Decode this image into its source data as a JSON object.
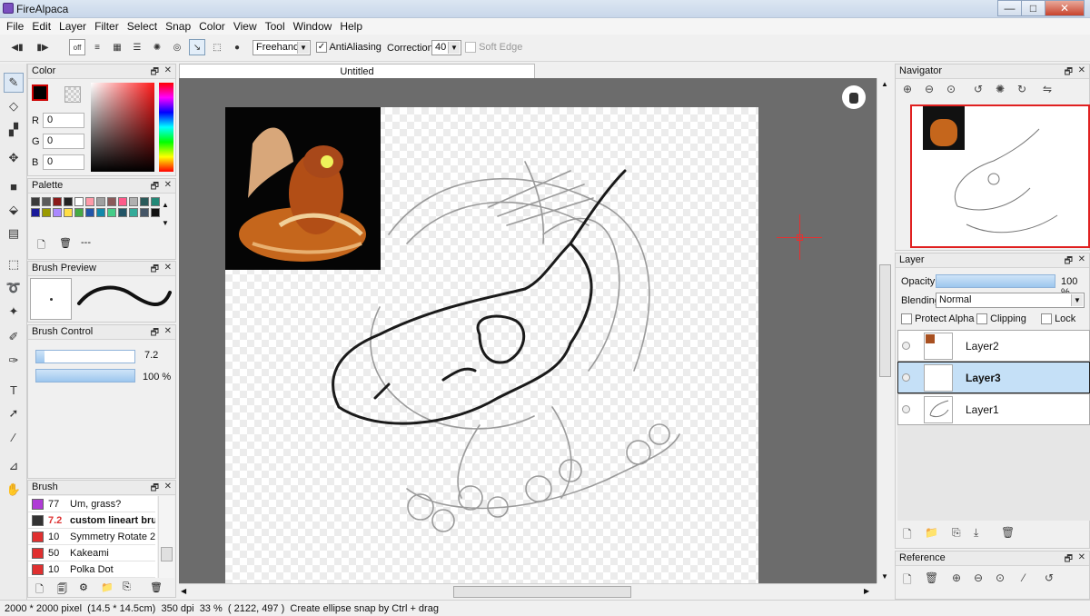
{
  "window": {
    "title": "FireAlpaca",
    "minimize": "—",
    "maximize": "□",
    "close": "✕"
  },
  "menu": [
    "File",
    "Edit",
    "Layer",
    "Filter",
    "Select",
    "Snap",
    "Color",
    "View",
    "Tool",
    "Window",
    "Help"
  ],
  "toolbar": {
    "off_label": "off",
    "brush_mode": "Freehand",
    "antialiasing_label": "AntiAliasing",
    "antialiasing_checked": true,
    "correction_label": "Correction",
    "correction_value": "40",
    "soft_edge_label": "Soft Edge",
    "soft_edge_checked": false
  },
  "document_tab": "Untitled",
  "color_panel": {
    "title": "Color",
    "r_label": "R",
    "r_value": "0",
    "g_label": "G",
    "g_value": "0",
    "b_label": "B",
    "b_value": "0",
    "primary_color": "#000000",
    "secondary_color": "#ffffff"
  },
  "palette_panel": {
    "title": "Palette",
    "more_label": "---",
    "swatches": [
      "#3a3a3a",
      "#5b5b5b",
      "#8b1a1a",
      "#222222",
      "#ffffff",
      "#ff9aa8",
      "#a0a0a0",
      "#8a5a5a",
      "#ff5a8a",
      "#b0b0b0",
      "#2a5a5a",
      "#228877",
      "#1a1a9a",
      "#9a9a00",
      "#aa88ff",
      "#ffdd44",
      "#44aa44",
      "#2255aa",
      "#1188aa",
      "#44cc88",
      "#225566",
      "#33aa99",
      "#445566",
      "#111111"
    ]
  },
  "brush_preview_panel": {
    "title": "Brush Preview"
  },
  "brush_control_panel": {
    "title": "Brush Control",
    "size_value": "7.2",
    "size_fraction": 0.08,
    "opacity_value": "100 %",
    "opacity_fraction": 1.0
  },
  "brush_panel": {
    "title": "Brush",
    "items": [
      {
        "size": "77",
        "name": "Um, grass?",
        "color": "#b03bd6"
      },
      {
        "size": "7.2",
        "name": "custom lineart brush",
        "color": "#333333",
        "selected": true
      },
      {
        "size": "10",
        "name": "Symmetry Rotate 2",
        "color": "#e03030"
      },
      {
        "size": "50",
        "name": "Kakeami",
        "color": "#e03030"
      },
      {
        "size": "10",
        "name": "Polka Dot",
        "color": "#e03030"
      }
    ]
  },
  "navigator_panel": {
    "title": "Navigator"
  },
  "layer_panel": {
    "title": "Layer",
    "opacity_label": "Opacity",
    "opacity_value": "100 %",
    "opacity_fraction": 1.0,
    "blending_label": "Blending",
    "blending_value": "Normal",
    "protect_alpha_label": "Protect Alpha",
    "clipping_label": "Clipping",
    "lock_label": "Lock",
    "layers": [
      {
        "name": "Layer2",
        "selected": false
      },
      {
        "name": "Layer3",
        "selected": true
      },
      {
        "name": "Layer1",
        "selected": false
      }
    ]
  },
  "reference_panel": {
    "title": "Reference"
  },
  "status": {
    "dimensions": "2000 * 2000 pixel",
    "physical": "(14.5 * 14.5cm)",
    "dpi": "350 dpi",
    "zoom": "33 %",
    "cursor": "( 2122, 497 )",
    "hint": "Create ellipse snap by Ctrl + drag"
  },
  "colors": {
    "selection_blue": "#c5e0f7",
    "canvas_bg": "#6c6c6c",
    "navigator_frame": "#e02020"
  }
}
